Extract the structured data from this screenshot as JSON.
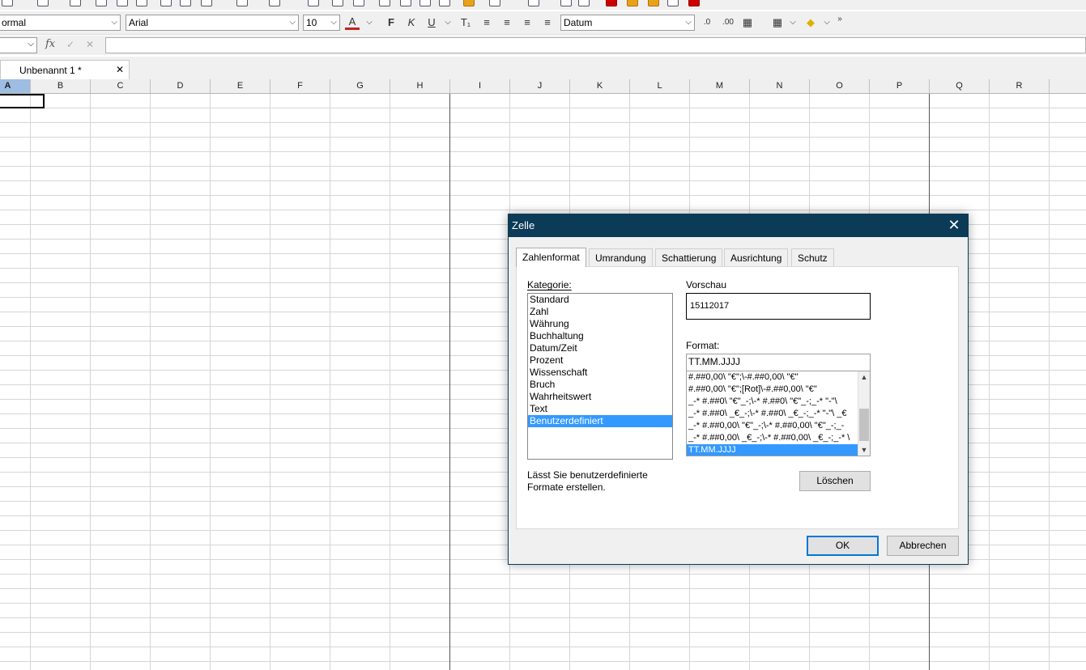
{
  "format_bar": {
    "style_value": "ormal",
    "font_name": "Arial",
    "font_size": "10",
    "bold": "F",
    "italic": "K",
    "underline": "U",
    "number_format": "Datum"
  },
  "formula_bar": {
    "fx_label": "fx",
    "accept_glyph": "✓",
    "cancel_glyph": "✕"
  },
  "document": {
    "tab_title": "Unbenannt 1 *",
    "tab_close": "✕"
  },
  "columns": [
    "A",
    "B",
    "C",
    "D",
    "E",
    "F",
    "G",
    "H",
    "I",
    "J",
    "K",
    "L",
    "M",
    "N",
    "O",
    "P",
    "Q",
    "R"
  ],
  "dialog": {
    "title": "Zelle",
    "close_glyph": "✕",
    "tabs": [
      "Zahlenformat",
      "Umrandung",
      "Schattierung",
      "Ausrichtung",
      "Schutz"
    ],
    "category_label": "Kategorie:",
    "categories": [
      "Standard",
      "Zahl",
      "Währung",
      "Buchhaltung",
      "Datum/Zeit",
      "Prozent",
      "Wissenschaft",
      "Bruch",
      "Wahrheitswert",
      "Text",
      "Benutzerdefiniert"
    ],
    "selected_category": "Benutzerdefiniert",
    "preview_label": "Vorschau",
    "preview_value": "15112017",
    "format_label": "Format:",
    "format_value": "TT.MM.JJJJ",
    "format_codes": [
      "#.##0,00\\ \"€\";\\-#.##0,00\\ \"€\"",
      "#.##0,00\\ \"€\";[Rot]\\-#.##0,00\\ \"€\"",
      "_-* #.##0\\ \"€\"_-;\\-* #.##0\\ \"€\"_-;_-* \"-\"\\",
      "_-* #.##0\\ _€_-;\\-* #.##0\\ _€_-;_-* \"-\"\\ _€",
      "_-* #.##0,00\\ \"€\"_-;\\-* #.##0,00\\ \"€\"_-;_-",
      "_-* #.##0,00\\ _€_-;\\-* #.##0,00\\ _€_-;_-* \\",
      "TT.MM.JJJJ"
    ],
    "selected_format": "TT.MM.JJJJ",
    "description": [
      "Lässt Sie benutzerdefinierte",
      "Formate erstellen."
    ],
    "delete_button": "Löschen",
    "ok_button": "OK",
    "cancel_button": "Abbrechen"
  },
  "colors": {
    "title_bar": "#0b3b57",
    "selection": "#3399ff",
    "default_button_border": "#0078d7"
  }
}
